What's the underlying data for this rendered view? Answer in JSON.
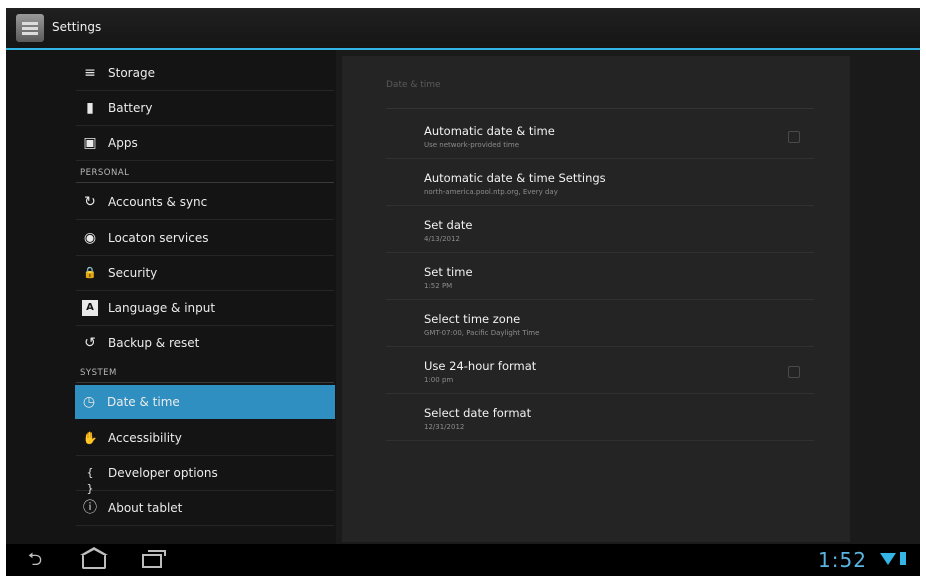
{
  "app": {
    "title": "Settings"
  },
  "sidebar": {
    "items_top": [
      {
        "label": "Storage",
        "icon": "storage-icon",
        "glyph": "≡"
      },
      {
        "label": "Battery",
        "icon": "battery-icon",
        "glyph": "▮"
      },
      {
        "label": "Apps",
        "icon": "apps-icon",
        "glyph": "▣"
      }
    ],
    "personal_header": "PERSONAL",
    "items_personal": [
      {
        "label": "Accounts & sync",
        "icon": "sync-icon",
        "glyph": "↻"
      },
      {
        "label": "Locaton services",
        "icon": "location-icon",
        "glyph": "◉"
      },
      {
        "label": "Security",
        "icon": "lock-icon",
        "glyph": "🔒"
      },
      {
        "label": "Language & input",
        "icon": "language-icon",
        "glyph": "A"
      },
      {
        "label": "Backup & reset",
        "icon": "backup-icon",
        "glyph": "↺"
      }
    ],
    "system_header": "SYSTEM",
    "items_system": [
      {
        "label": "Date & time",
        "icon": "clock-icon",
        "glyph": "◷",
        "selected": true
      },
      {
        "label": "Accessibility",
        "icon": "hand-icon",
        "glyph": "✋"
      },
      {
        "label": "Developer options",
        "icon": "braces-icon",
        "glyph": "{ }"
      },
      {
        "label": "About tablet",
        "icon": "info-icon",
        "glyph": "ⓘ"
      }
    ]
  },
  "main": {
    "breadcrumb": "Date & time",
    "prefs": [
      {
        "title": "Automatic date & time",
        "summary": "Use network-provided time",
        "checkbox": true
      },
      {
        "title": "Automatic date & time Settings",
        "summary": "north-america.pool.ntp.org, Every day",
        "checkbox": false
      },
      {
        "title": "Set date",
        "summary": "4/13/2012",
        "checkbox": false
      },
      {
        "title": "Set time",
        "summary": "1:52 PM",
        "checkbox": false
      },
      {
        "title": "Select time zone",
        "summary": "GMT-07:00, Pacific Daylight Time",
        "checkbox": false
      },
      {
        "title": "Use 24-hour format",
        "summary": "1:00 pm",
        "checkbox": true
      },
      {
        "title": "Select date format",
        "summary": "12/31/2012",
        "checkbox": false
      }
    ]
  },
  "navbar": {
    "back_icon": "back-icon",
    "home_icon": "home-icon",
    "recents_icon": "recents-icon",
    "clock": "1:52",
    "accent": "#33b5e5"
  },
  "colors": {
    "selected": "#2f8fc0",
    "accent": "#33b5e5",
    "background": "#0b0b0b"
  }
}
